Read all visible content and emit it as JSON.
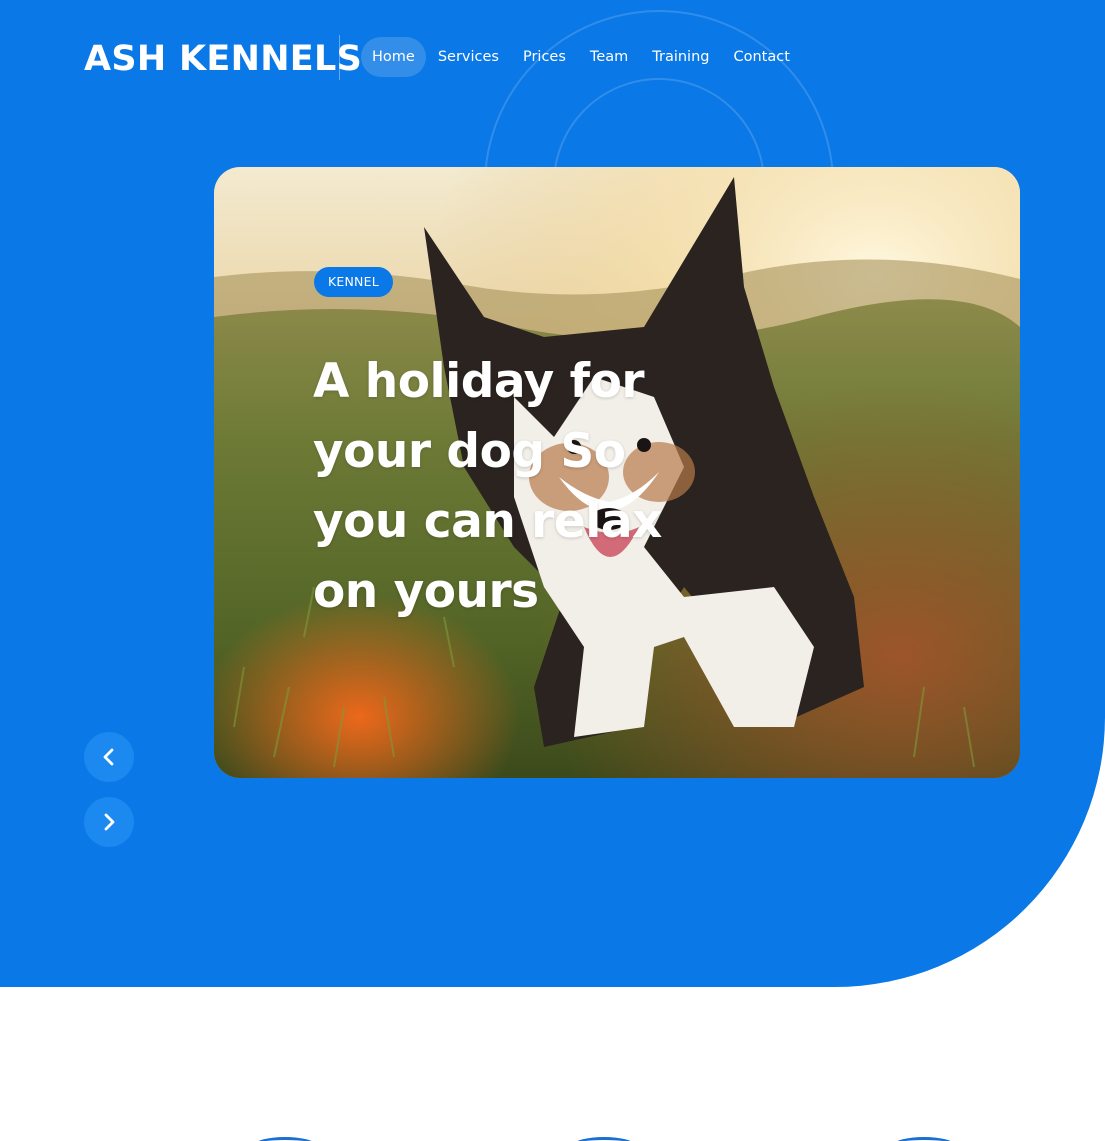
{
  "brand": {
    "name": "ASH KENNELS"
  },
  "nav": {
    "items": [
      {
        "label": "Home"
      },
      {
        "label": "Services"
      },
      {
        "label": "Prices"
      },
      {
        "label": "Team"
      },
      {
        "label": "Training"
      },
      {
        "label": "Contact"
      }
    ],
    "active": "Home"
  },
  "hero": {
    "badge": "KENNEL",
    "headline": "A holiday for your dog So you can relax on yours"
  },
  "slider": {
    "prev_icon": "chevron-left-icon",
    "next_icon": "chevron-right-icon"
  },
  "colors": {
    "primary": "#0a78e6",
    "button": "#1b89f0",
    "text_light": "#ffffff"
  }
}
